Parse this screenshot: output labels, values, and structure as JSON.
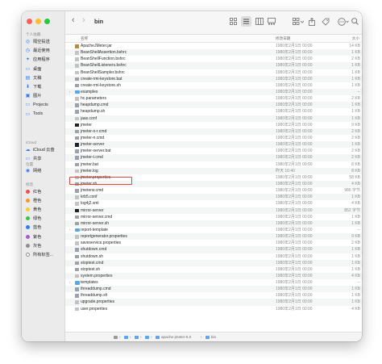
{
  "window": {
    "title": "bin"
  },
  "traffic_lights": [
    "#ff5f57",
    "#febc2e",
    "#28c840"
  ],
  "toolbar": {
    "back": "‹",
    "forward": "›"
  },
  "sidebar": {
    "favorites_label": "个人收藏",
    "favorites": [
      {
        "label": "隔空投送",
        "icon": "airdrop-icon",
        "glyph": "◎"
      },
      {
        "label": "最近使用",
        "icon": "clock-icon",
        "glyph": "◷"
      },
      {
        "label": "应用程序",
        "icon": "apps-icon",
        "glyph": "✦"
      },
      {
        "label": "桌面",
        "icon": "desktop-icon",
        "glyph": "▭"
      },
      {
        "label": "文稿",
        "icon": "document-icon",
        "glyph": "▤"
      },
      {
        "label": "下载",
        "icon": "download-icon",
        "glyph": "⬇"
      },
      {
        "label": "图片",
        "icon": "pictures-icon",
        "glyph": "▣"
      },
      {
        "label": "Projects",
        "icon": "folder-icon",
        "glyph": "▭"
      },
      {
        "label": "Tools",
        "icon": "folder-icon",
        "glyph": "▭"
      }
    ],
    "icloud_label": "iCloud",
    "icloud": [
      {
        "label": "iCloud 云盘",
        "icon": "cloud-icon",
        "glyph": "☁"
      },
      {
        "label": "共享",
        "icon": "shared-folder-icon",
        "glyph": "▭"
      }
    ],
    "locations_label": "位置",
    "locations": [
      {
        "label": "网络",
        "icon": "network-icon",
        "glyph": "◉"
      }
    ],
    "tags_label": "标签",
    "tags": [
      {
        "label": "红色",
        "color": "#f04e4e"
      },
      {
        "label": "橙色",
        "color": "#f7962a"
      },
      {
        "label": "黄色",
        "color": "#f6cf2c"
      },
      {
        "label": "绿色",
        "color": "#39c447"
      },
      {
        "label": "蓝色",
        "color": "#2f7bf5"
      },
      {
        "label": "紫色",
        "color": "#a659d6"
      },
      {
        "label": "灰色",
        "color": "#8e8e93"
      },
      {
        "label": "所有标签...",
        "color": "#ffffff"
      }
    ]
  },
  "columns": {
    "name": "名称",
    "date": "修改日期",
    "size": "大小"
  },
  "files": [
    {
      "name": "ApacheJMeter.jar",
      "date": "1980年2月1日 00:00",
      "size": "14 KB",
      "kind": "jar"
    },
    {
      "name": "BeanShellAssertion.bshrc",
      "date": "1980年2月1日 00:00",
      "size": "1 KB",
      "kind": "doc"
    },
    {
      "name": "BeanShellFunction.bshrc",
      "date": "1980年2月1日 00:00",
      "size": "2 KB",
      "kind": "doc"
    },
    {
      "name": "BeanShellListeners.bshrc",
      "date": "1980年2月1日 00:00",
      "size": "1 KB",
      "kind": "doc"
    },
    {
      "name": "BeanShellSampler.bshrc",
      "date": "1980年2月1日 00:00",
      "size": "1 KB",
      "kind": "doc"
    },
    {
      "name": "create-rmi-keystore.bat",
      "date": "1980年2月1日 00:00",
      "size": "1 KB",
      "kind": "script"
    },
    {
      "name": "create-rmi-keystore.sh",
      "date": "1980年2月1日 00:00",
      "size": "1 KB",
      "kind": "script"
    },
    {
      "name": "examples",
      "date": "1980年2月1日 00:00",
      "size": "--",
      "kind": "folder"
    },
    {
      "name": "hc.parameters",
      "date": "1980年2月1日 00:00",
      "size": "2 KB",
      "kind": "doc"
    },
    {
      "name": "heapdump.cmd",
      "date": "1980年2月1日 00:00",
      "size": "1 KB",
      "kind": "script"
    },
    {
      "name": "heapdump.sh",
      "date": "1980年2月1日 00:00",
      "size": "1 KB",
      "kind": "script"
    },
    {
      "name": "jaas.conf",
      "date": "1980年2月1日 00:00",
      "size": "1 KB",
      "kind": "doc"
    },
    {
      "name": "jmeter",
      "date": "1980年2月1日 00:00",
      "size": "9 KB",
      "kind": "exec"
    },
    {
      "name": "jmeter-n-r.cmd",
      "date": "1980年2月1日 00:00",
      "size": "2 KB",
      "kind": "script"
    },
    {
      "name": "jmeter-n.cmd",
      "date": "1980年2月1日 00:00",
      "size": "2 KB",
      "kind": "script"
    },
    {
      "name": "jmeter-server",
      "date": "1980年2月1日 00:00",
      "size": "1 KB",
      "kind": "exec"
    },
    {
      "name": "jmeter-server.bat",
      "date": "1980年2月1日 00:00",
      "size": "2 KB",
      "kind": "script"
    },
    {
      "name": "jmeter-t.cmd",
      "date": "1980年2月1日 00:00",
      "size": "2 KB",
      "kind": "script"
    },
    {
      "name": "jmeter.bat",
      "date": "1980年2月1日 00:00",
      "size": "8 KB",
      "kind": "script"
    },
    {
      "name": "jmeter.log",
      "date": "昨天 16:40",
      "size": "8 KB",
      "kind": "doc"
    },
    {
      "name": "jmeter.properties",
      "date": "1980年2月1日 00:00",
      "size": "58 KB",
      "kind": "doc"
    },
    {
      "name": "jmeter.sh",
      "date": "1980年2月1日 00:00",
      "size": "4 KB",
      "kind": "script"
    },
    {
      "name": "jmeterw.cmd",
      "date": "1980年2月1日 00:00",
      "size": "986 字节",
      "kind": "script"
    },
    {
      "name": "krb5.conf",
      "date": "1980年2月1日 00:00",
      "size": "1 KB",
      "kind": "doc"
    },
    {
      "name": "log4j2.xml",
      "date": "1980年2月1日 00:00",
      "size": "4 KB",
      "kind": "doc"
    },
    {
      "name": "mirror-server",
      "date": "1980年2月1日 00:00",
      "size": "852 字节",
      "kind": "exec"
    },
    {
      "name": "mirror-server.cmd",
      "date": "1980年2月1日 00:00",
      "size": "1 KB",
      "kind": "script"
    },
    {
      "name": "mirror-server.sh",
      "date": "1980年2月1日 00:00",
      "size": "1 KB",
      "kind": "script"
    },
    {
      "name": "report-template",
      "date": "1980年2月1日 00:00",
      "size": "--",
      "kind": "folder"
    },
    {
      "name": "reportgenerator.properties",
      "date": "1980年2月1日 00:00",
      "size": "9 KB",
      "kind": "doc"
    },
    {
      "name": "saveservice.properties",
      "date": "1980年2月1日 00:00",
      "size": "2 KB",
      "kind": "doc"
    },
    {
      "name": "shutdown.cmd",
      "date": "1980年2月1日 00:00",
      "size": "1 KB",
      "kind": "script"
    },
    {
      "name": "shutdown.sh",
      "date": "1980年2月1日 00:00",
      "size": "1 KB",
      "kind": "script"
    },
    {
      "name": "stoptest.cmd",
      "date": "1980年2月1日 00:00",
      "size": "1 KB",
      "kind": "script"
    },
    {
      "name": "stoptest.sh",
      "date": "1980年2月1日 00:00",
      "size": "1 KB",
      "kind": "script"
    },
    {
      "name": "system.properties",
      "date": "1980年2月1日 00:00",
      "size": "4 KB",
      "kind": "doc"
    },
    {
      "name": "templates",
      "date": "1980年2月1日 00:00",
      "size": "--",
      "kind": "folder"
    },
    {
      "name": "threaddump.cmd",
      "date": "1980年2月1日 00:00",
      "size": "1 KB",
      "kind": "script"
    },
    {
      "name": "threaddump.sh",
      "date": "1980年2月1日 00:00",
      "size": "1 KB",
      "kind": "script"
    },
    {
      "name": "upgrade.properties",
      "date": "1980年2月1日 00:00",
      "size": "1 KB",
      "kind": "doc"
    },
    {
      "name": "user.properties",
      "date": "1980年2月1日 00:00",
      "size": "4 KB",
      "kind": "doc"
    }
  ],
  "selected_file": "jmeter.bat",
  "pathbar": [
    {
      "label": "",
      "icon": "disk-icon"
    },
    {
      "label": "",
      "icon": "folder-icon"
    },
    {
      "label": "",
      "icon": "folder-icon"
    },
    {
      "label": "",
      "icon": "folder-icon"
    },
    {
      "label": "apache-jmeter-5.0",
      "icon": "folder-icon"
    },
    {
      "label": "bin",
      "icon": "folder-icon"
    }
  ]
}
